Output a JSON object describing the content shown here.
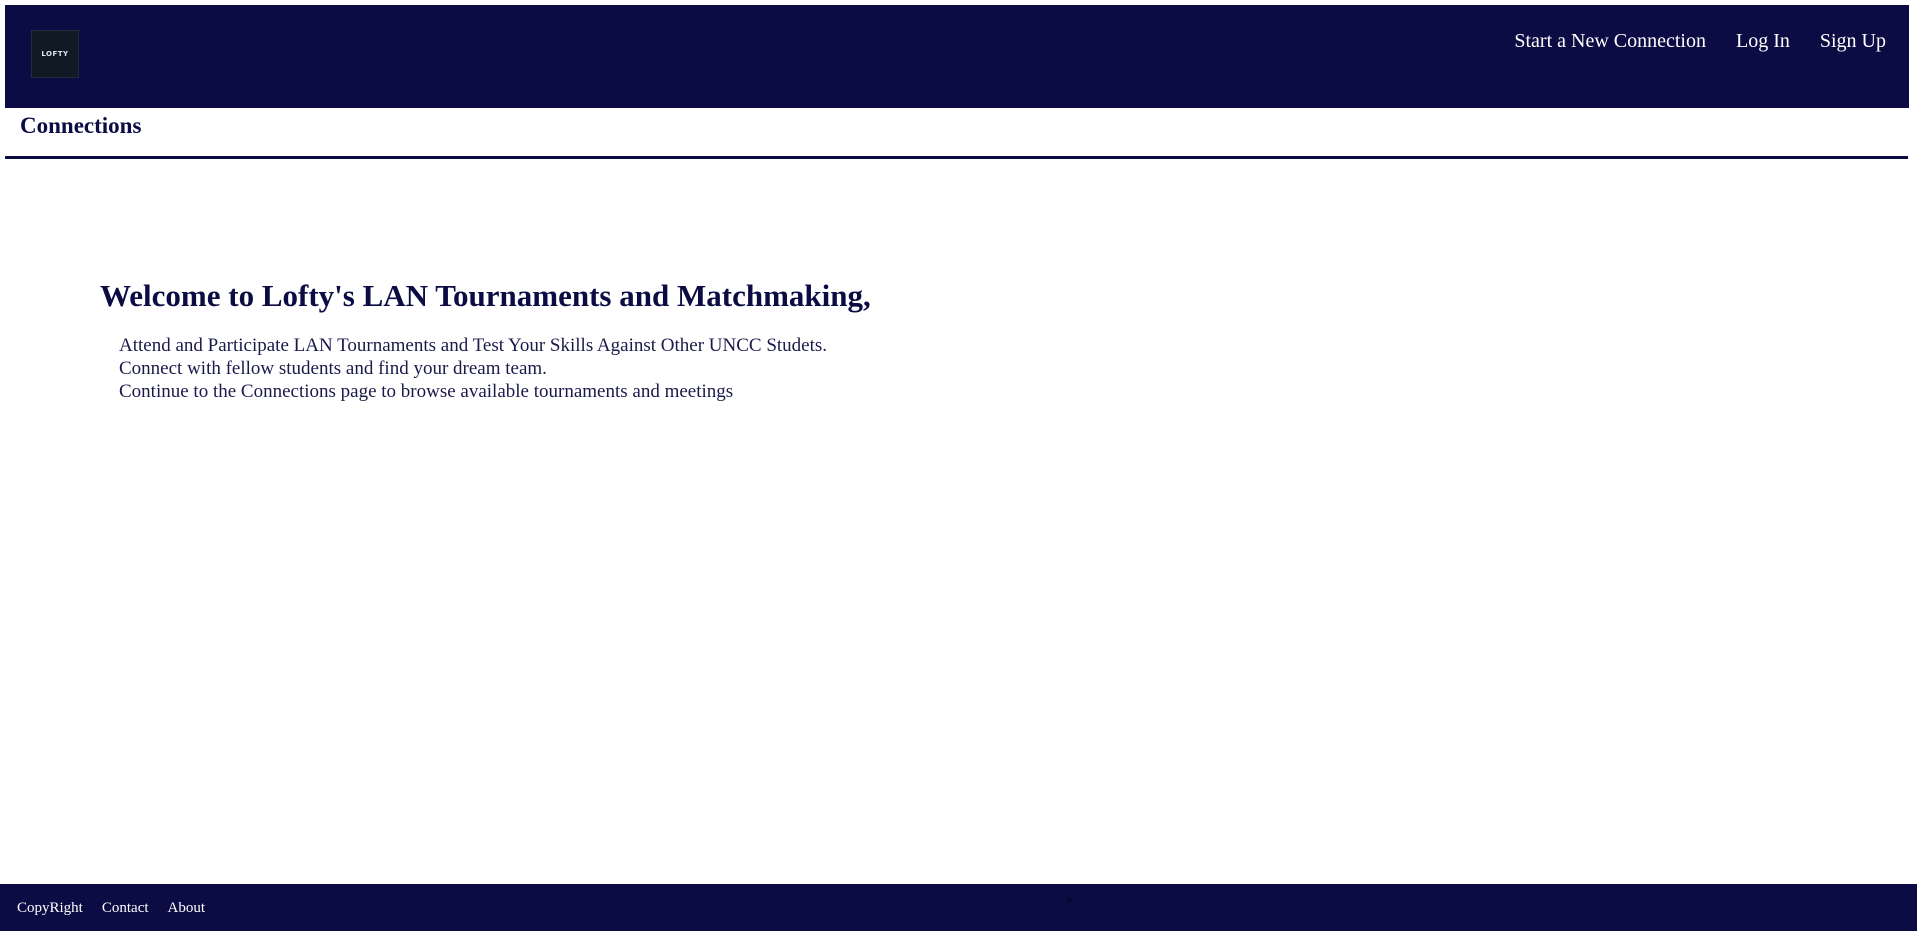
{
  "header": {
    "logo_text": "LOFTY",
    "nav": {
      "new_connection": "Start a New Connection",
      "login": "Log In",
      "signup": "Sign Up"
    }
  },
  "subnav": {
    "connections": "Connections"
  },
  "main": {
    "title": "Welcome to Lofty's LAN Tournaments and Matchmaking,",
    "lines": [
      "Attend and Participate LAN Tournaments and Test Your Skills Against Other UNCC Studets.",
      "Connect with fellow students and find your dream team.",
      "Continue to the Connections page to browse available tournaments and meetings"
    ]
  },
  "footer": {
    "copyright": "CopyRight",
    "contact": "Contact",
    "about": "About",
    "mark": ">"
  },
  "colors": {
    "brand": "#0c0c45",
    "background": "#ffffff"
  }
}
